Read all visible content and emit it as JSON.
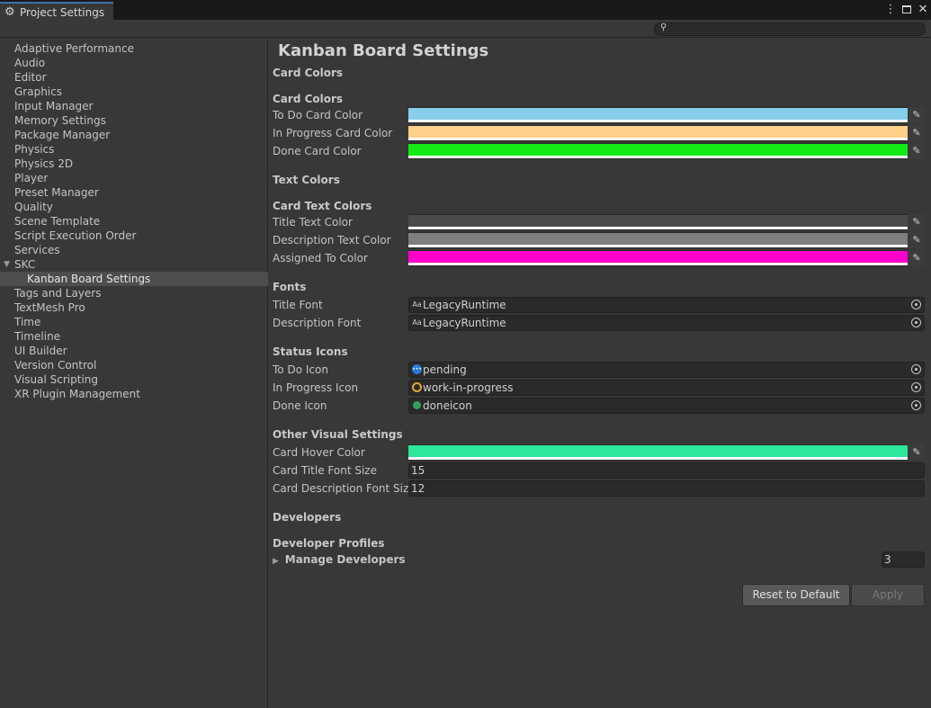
{
  "window": {
    "tab_title": "Project Settings"
  },
  "sidebar": {
    "items": [
      {
        "label": "Adaptive Performance"
      },
      {
        "label": "Audio"
      },
      {
        "label": "Editor"
      },
      {
        "label": "Graphics"
      },
      {
        "label": "Input Manager"
      },
      {
        "label": "Memory Settings"
      },
      {
        "label": "Package Manager"
      },
      {
        "label": "Physics"
      },
      {
        "label": "Physics 2D"
      },
      {
        "label": "Player"
      },
      {
        "label": "Preset Manager"
      },
      {
        "label": "Quality"
      },
      {
        "label": "Scene Template"
      },
      {
        "label": "Script Execution Order"
      },
      {
        "label": "Services"
      },
      {
        "label": "SKC"
      },
      {
        "label": "Kanban Board Settings"
      },
      {
        "label": "Tags and Layers"
      },
      {
        "label": "TextMesh Pro"
      },
      {
        "label": "Time"
      },
      {
        "label": "Timeline"
      },
      {
        "label": "UI Builder"
      },
      {
        "label": "Version Control"
      },
      {
        "label": "Visual Scripting"
      },
      {
        "label": "XR Plugin Management"
      }
    ],
    "selected": "Kanban Board Settings"
  },
  "main": {
    "title": "Kanban Board Settings",
    "card_colors": {
      "header": "Card Colors",
      "subheader": "Card Colors",
      "todo_label": "To Do Card Color",
      "todo_color": "#87ceeb",
      "inprogress_label": "In Progress Card Color",
      "inprogress_color": "#ffd08a",
      "done_label": "Done Card Color",
      "done_color": "#14ea14"
    },
    "text_colors": {
      "header": "Text Colors",
      "subheader": "Card Text Colors",
      "title_label": "Title Text Color",
      "title_color": "#4a4a4a",
      "desc_label": "Description Text Color",
      "desc_color": "#7e7e7e",
      "assigned_label": "Assigned To Color",
      "assigned_color": "#ff00cc"
    },
    "fonts": {
      "header": "Fonts",
      "title_label": "Title Font",
      "title_value": "LegacyRuntime",
      "desc_label": "Description Font",
      "desc_value": "LegacyRuntime"
    },
    "status_icons": {
      "header": "Status Icons",
      "todo_label": "To Do Icon",
      "todo_value": "pending",
      "inprogress_label": "In Progress Icon",
      "inprogress_value": "work-in-progress",
      "done_label": "Done Icon",
      "done_value": "doneicon"
    },
    "other_visual": {
      "header": "Other Visual Settings",
      "hover_label": "Card Hover Color",
      "hover_color": "#2de89b",
      "title_size_label": "Card Title Font Size",
      "title_size_value": "15",
      "desc_size_label": "Card Description Font Size",
      "desc_size_value": "12"
    },
    "developers": {
      "header": "Developers",
      "subheader": "Developer Profiles",
      "foldout_label": "Manage Developers",
      "count": "3"
    },
    "buttons": {
      "reset": "Reset to Default",
      "apply": "Apply"
    }
  }
}
